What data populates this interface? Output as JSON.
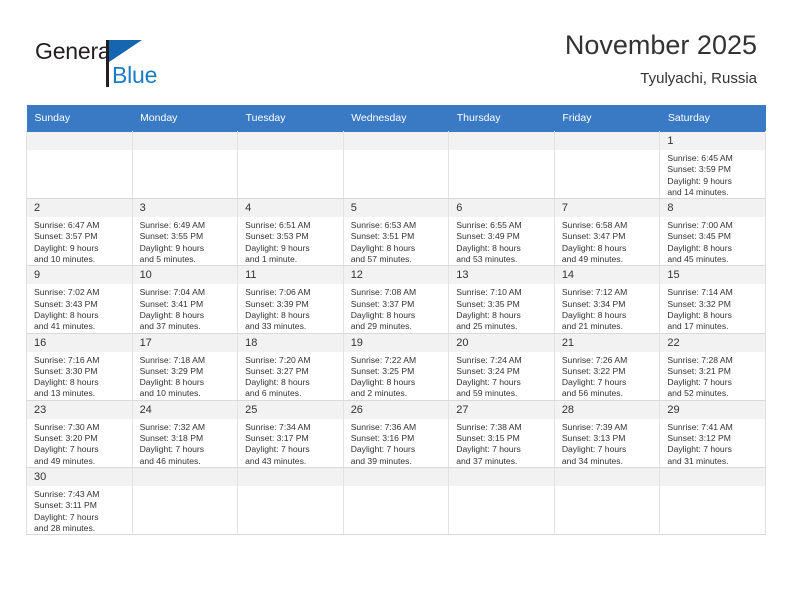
{
  "logo": {
    "word_one": "General",
    "word_two": "Blue",
    "icon": "flag-triangle-icon",
    "color_primary": "#1565b0",
    "color_secondary": "#1a7cc4"
  },
  "header": {
    "title": "November 2025",
    "subtitle": "Tyulyachi, Russia"
  },
  "theme": {
    "header_row_bg": "#3a79c4",
    "daynum_bg": "#f2f2f2",
    "cell_border": "#e2e2e2",
    "text": "#333333"
  },
  "weekdays": [
    "Sunday",
    "Monday",
    "Tuesday",
    "Wednesday",
    "Thursday",
    "Friday",
    "Saturday"
  ],
  "labels": {
    "sunrise_prefix": "Sunrise:",
    "sunset_prefix": "Sunset:",
    "daylight_prefix": "Daylight:"
  },
  "weeks": [
    [
      {
        "day": "",
        "blank": true,
        "sunrise": "",
        "sunset": "",
        "daylight_line1": "",
        "daylight_line2": ""
      },
      {
        "day": "",
        "blank": true,
        "sunrise": "",
        "sunset": "",
        "daylight_line1": "",
        "daylight_line2": ""
      },
      {
        "day": "",
        "blank": true,
        "sunrise": "",
        "sunset": "",
        "daylight_line1": "",
        "daylight_line2": ""
      },
      {
        "day": "",
        "blank": true,
        "sunrise": "",
        "sunset": "",
        "daylight_line1": "",
        "daylight_line2": ""
      },
      {
        "day": "",
        "blank": true,
        "sunrise": "",
        "sunset": "",
        "daylight_line1": "",
        "daylight_line2": ""
      },
      {
        "day": "",
        "blank": true,
        "sunrise": "",
        "sunset": "",
        "daylight_line1": "",
        "daylight_line2": ""
      },
      {
        "day": "1",
        "blank": false,
        "sunrise": "Sunrise: 6:45 AM",
        "sunset": "Sunset: 3:59 PM",
        "daylight_line1": "Daylight: 9 hours",
        "daylight_line2": "and 14 minutes."
      }
    ],
    [
      {
        "day": "2",
        "blank": false,
        "sunrise": "Sunrise: 6:47 AM",
        "sunset": "Sunset: 3:57 PM",
        "daylight_line1": "Daylight: 9 hours",
        "daylight_line2": "and 10 minutes."
      },
      {
        "day": "3",
        "blank": false,
        "sunrise": "Sunrise: 6:49 AM",
        "sunset": "Sunset: 3:55 PM",
        "daylight_line1": "Daylight: 9 hours",
        "daylight_line2": "and 5 minutes."
      },
      {
        "day": "4",
        "blank": false,
        "sunrise": "Sunrise: 6:51 AM",
        "sunset": "Sunset: 3:53 PM",
        "daylight_line1": "Daylight: 9 hours",
        "daylight_line2": "and 1 minute."
      },
      {
        "day": "5",
        "blank": false,
        "sunrise": "Sunrise: 6:53 AM",
        "sunset": "Sunset: 3:51 PM",
        "daylight_line1": "Daylight: 8 hours",
        "daylight_line2": "and 57 minutes."
      },
      {
        "day": "6",
        "blank": false,
        "sunrise": "Sunrise: 6:55 AM",
        "sunset": "Sunset: 3:49 PM",
        "daylight_line1": "Daylight: 8 hours",
        "daylight_line2": "and 53 minutes."
      },
      {
        "day": "7",
        "blank": false,
        "sunrise": "Sunrise: 6:58 AM",
        "sunset": "Sunset: 3:47 PM",
        "daylight_line1": "Daylight: 8 hours",
        "daylight_line2": "and 49 minutes."
      },
      {
        "day": "8",
        "blank": false,
        "sunrise": "Sunrise: 7:00 AM",
        "sunset": "Sunset: 3:45 PM",
        "daylight_line1": "Daylight: 8 hours",
        "daylight_line2": "and 45 minutes."
      }
    ],
    [
      {
        "day": "9",
        "blank": false,
        "sunrise": "Sunrise: 7:02 AM",
        "sunset": "Sunset: 3:43 PM",
        "daylight_line1": "Daylight: 8 hours",
        "daylight_line2": "and 41 minutes."
      },
      {
        "day": "10",
        "blank": false,
        "sunrise": "Sunrise: 7:04 AM",
        "sunset": "Sunset: 3:41 PM",
        "daylight_line1": "Daylight: 8 hours",
        "daylight_line2": "and 37 minutes."
      },
      {
        "day": "11",
        "blank": false,
        "sunrise": "Sunrise: 7:06 AM",
        "sunset": "Sunset: 3:39 PM",
        "daylight_line1": "Daylight: 8 hours",
        "daylight_line2": "and 33 minutes."
      },
      {
        "day": "12",
        "blank": false,
        "sunrise": "Sunrise: 7:08 AM",
        "sunset": "Sunset: 3:37 PM",
        "daylight_line1": "Daylight: 8 hours",
        "daylight_line2": "and 29 minutes."
      },
      {
        "day": "13",
        "blank": false,
        "sunrise": "Sunrise: 7:10 AM",
        "sunset": "Sunset: 3:35 PM",
        "daylight_line1": "Daylight: 8 hours",
        "daylight_line2": "and 25 minutes."
      },
      {
        "day": "14",
        "blank": false,
        "sunrise": "Sunrise: 7:12 AM",
        "sunset": "Sunset: 3:34 PM",
        "daylight_line1": "Daylight: 8 hours",
        "daylight_line2": "and 21 minutes."
      },
      {
        "day": "15",
        "blank": false,
        "sunrise": "Sunrise: 7:14 AM",
        "sunset": "Sunset: 3:32 PM",
        "daylight_line1": "Daylight: 8 hours",
        "daylight_line2": "and 17 minutes."
      }
    ],
    [
      {
        "day": "16",
        "blank": false,
        "sunrise": "Sunrise: 7:16 AM",
        "sunset": "Sunset: 3:30 PM",
        "daylight_line1": "Daylight: 8 hours",
        "daylight_line2": "and 13 minutes."
      },
      {
        "day": "17",
        "blank": false,
        "sunrise": "Sunrise: 7:18 AM",
        "sunset": "Sunset: 3:29 PM",
        "daylight_line1": "Daylight: 8 hours",
        "daylight_line2": "and 10 minutes."
      },
      {
        "day": "18",
        "blank": false,
        "sunrise": "Sunrise: 7:20 AM",
        "sunset": "Sunset: 3:27 PM",
        "daylight_line1": "Daylight: 8 hours",
        "daylight_line2": "and 6 minutes."
      },
      {
        "day": "19",
        "blank": false,
        "sunrise": "Sunrise: 7:22 AM",
        "sunset": "Sunset: 3:25 PM",
        "daylight_line1": "Daylight: 8 hours",
        "daylight_line2": "and 2 minutes."
      },
      {
        "day": "20",
        "blank": false,
        "sunrise": "Sunrise: 7:24 AM",
        "sunset": "Sunset: 3:24 PM",
        "daylight_line1": "Daylight: 7 hours",
        "daylight_line2": "and 59 minutes."
      },
      {
        "day": "21",
        "blank": false,
        "sunrise": "Sunrise: 7:26 AM",
        "sunset": "Sunset: 3:22 PM",
        "daylight_line1": "Daylight: 7 hours",
        "daylight_line2": "and 56 minutes."
      },
      {
        "day": "22",
        "blank": false,
        "sunrise": "Sunrise: 7:28 AM",
        "sunset": "Sunset: 3:21 PM",
        "daylight_line1": "Daylight: 7 hours",
        "daylight_line2": "and 52 minutes."
      }
    ],
    [
      {
        "day": "23",
        "blank": false,
        "sunrise": "Sunrise: 7:30 AM",
        "sunset": "Sunset: 3:20 PM",
        "daylight_line1": "Daylight: 7 hours",
        "daylight_line2": "and 49 minutes."
      },
      {
        "day": "24",
        "blank": false,
        "sunrise": "Sunrise: 7:32 AM",
        "sunset": "Sunset: 3:18 PM",
        "daylight_line1": "Daylight: 7 hours",
        "daylight_line2": "and 46 minutes."
      },
      {
        "day": "25",
        "blank": false,
        "sunrise": "Sunrise: 7:34 AM",
        "sunset": "Sunset: 3:17 PM",
        "daylight_line1": "Daylight: 7 hours",
        "daylight_line2": "and 43 minutes."
      },
      {
        "day": "26",
        "blank": false,
        "sunrise": "Sunrise: 7:36 AM",
        "sunset": "Sunset: 3:16 PM",
        "daylight_line1": "Daylight: 7 hours",
        "daylight_line2": "and 39 minutes."
      },
      {
        "day": "27",
        "blank": false,
        "sunrise": "Sunrise: 7:38 AM",
        "sunset": "Sunset: 3:15 PM",
        "daylight_line1": "Daylight: 7 hours",
        "daylight_line2": "and 37 minutes."
      },
      {
        "day": "28",
        "blank": false,
        "sunrise": "Sunrise: 7:39 AM",
        "sunset": "Sunset: 3:13 PM",
        "daylight_line1": "Daylight: 7 hours",
        "daylight_line2": "and 34 minutes."
      },
      {
        "day": "29",
        "blank": false,
        "sunrise": "Sunrise: 7:41 AM",
        "sunset": "Sunset: 3:12 PM",
        "daylight_line1": "Daylight: 7 hours",
        "daylight_line2": "and 31 minutes."
      }
    ],
    [
      {
        "day": "30",
        "blank": false,
        "sunrise": "Sunrise: 7:43 AM",
        "sunset": "Sunset: 3:11 PM",
        "daylight_line1": "Daylight: 7 hours",
        "daylight_line2": "and 28 minutes."
      },
      {
        "day": "",
        "blank": true,
        "sunrise": "",
        "sunset": "",
        "daylight_line1": "",
        "daylight_line2": ""
      },
      {
        "day": "",
        "blank": true,
        "sunrise": "",
        "sunset": "",
        "daylight_line1": "",
        "daylight_line2": ""
      },
      {
        "day": "",
        "blank": true,
        "sunrise": "",
        "sunset": "",
        "daylight_line1": "",
        "daylight_line2": ""
      },
      {
        "day": "",
        "blank": true,
        "sunrise": "",
        "sunset": "",
        "daylight_line1": "",
        "daylight_line2": ""
      },
      {
        "day": "",
        "blank": true,
        "sunrise": "",
        "sunset": "",
        "daylight_line1": "",
        "daylight_line2": ""
      },
      {
        "day": "",
        "blank": true,
        "sunrise": "",
        "sunset": "",
        "daylight_line1": "",
        "daylight_line2": ""
      }
    ]
  ]
}
